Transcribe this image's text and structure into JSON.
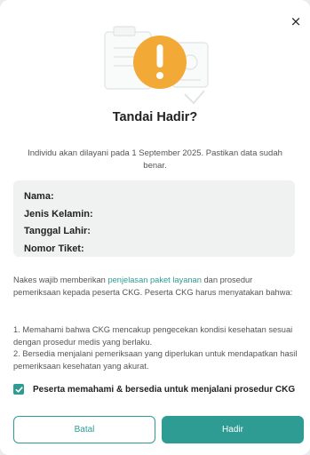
{
  "dialog": {
    "close_symbol": "×",
    "illustration_icon": "alert-exclamation-icon",
    "title": "Tandai Hadir?",
    "description": "Individu akan dilayani pada 1 September 2025. Pastikan data sudah benar.",
    "info_fields": {
      "name_label": "Nama:",
      "gender_label": "Jenis Kelamin:",
      "birthdate_label": "Tanggal Lahir:",
      "ticket_label": "Nomor Tiket:"
    },
    "notice": {
      "before_link": "Nakes wajib memberikan ",
      "link": "penjelasan paket layanan",
      "after_link": " dan prosedur pemeriksaan kepada peserta CKG. Peserta CKG harus menyatakan bahwa:"
    },
    "statements": [
      "1. Memahami bahwa CKG mencakup pengecekan kondisi kesehatan sesuai dengan prosedur medis yang berlaku.",
      "2. Bersedia menjalani pemeriksaan yang diperlukan untuk mendapatkan hasil pemeriksaan kesehatan yang akurat."
    ],
    "agreement": {
      "checked": true,
      "label": "Peserta memahami & bersedia untuk menjalani prosedur CKG"
    },
    "buttons": {
      "cancel": "Batal",
      "submit": "Hadir"
    },
    "colors": {
      "accent": "#2f9c93",
      "warning": "#f2a935"
    }
  }
}
